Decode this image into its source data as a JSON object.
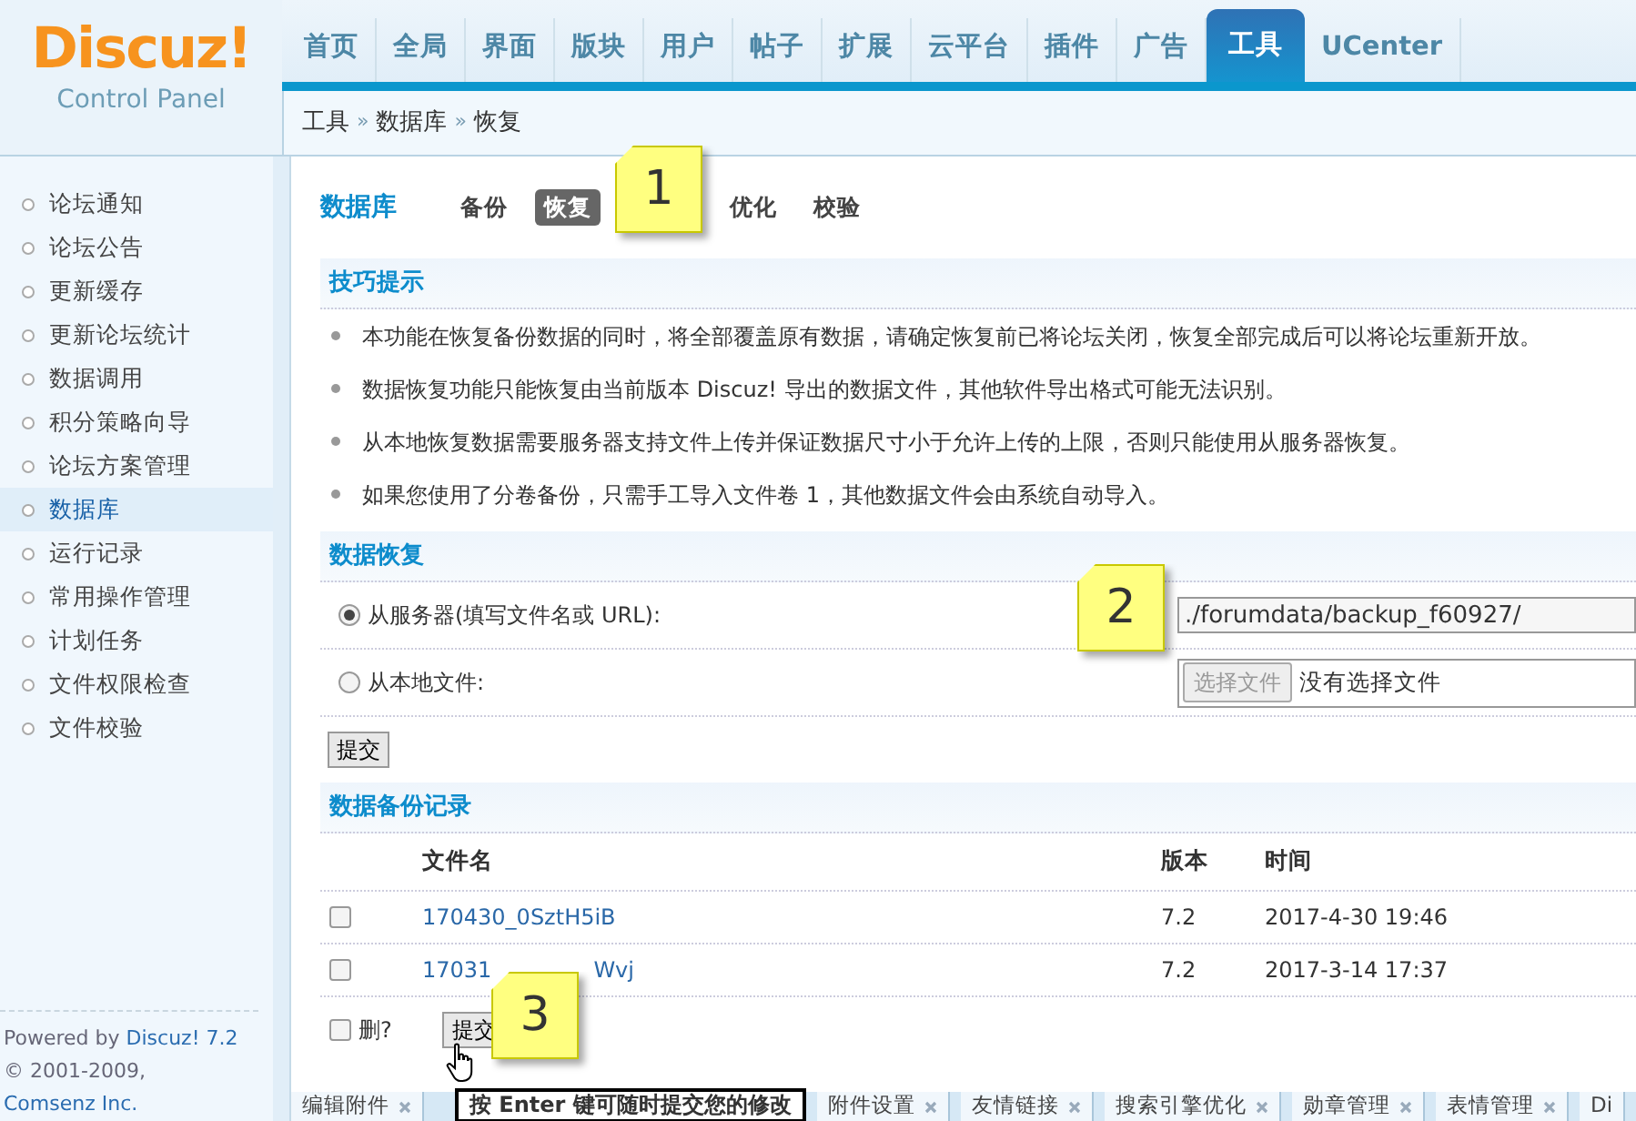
{
  "logo": {
    "title": "Discuz!",
    "subtitle": "Control Panel"
  },
  "nav_tabs": [
    {
      "label": "首页",
      "selected": false
    },
    {
      "label": "全局",
      "selected": false
    },
    {
      "label": "界面",
      "selected": false
    },
    {
      "label": "版块",
      "selected": false
    },
    {
      "label": "用户",
      "selected": false
    },
    {
      "label": "帖子",
      "selected": false
    },
    {
      "label": "扩展",
      "selected": false
    },
    {
      "label": "云平台",
      "selected": false
    },
    {
      "label": "插件",
      "selected": false
    },
    {
      "label": "广告",
      "selected": false
    },
    {
      "label": "工具",
      "selected": true
    },
    {
      "label": "UCenter",
      "selected": false
    }
  ],
  "breadcrumb": [
    "工具",
    "»",
    "数据库",
    "»",
    "恢复"
  ],
  "sidebar": {
    "items": [
      {
        "label": "论坛通知",
        "selected": false
      },
      {
        "label": "论坛公告",
        "selected": false
      },
      {
        "label": "更新缓存",
        "selected": false
      },
      {
        "label": "更新论坛统计",
        "selected": false
      },
      {
        "label": "数据调用",
        "selected": false
      },
      {
        "label": "积分策略向导",
        "selected": false
      },
      {
        "label": "论坛方案管理",
        "selected": false
      },
      {
        "label": "数据库",
        "selected": true
      },
      {
        "label": "运行记录",
        "selected": false
      },
      {
        "label": "常用操作管理",
        "selected": false
      },
      {
        "label": "计划任务",
        "selected": false
      },
      {
        "label": "文件权限检查",
        "selected": false
      },
      {
        "label": "文件校验",
        "selected": false
      }
    ]
  },
  "footer": {
    "powered": {
      "text": "Powered by",
      "link": "Discuz! 7.2"
    },
    "copyright": {
      "text": "© 2001-2009,",
      "link": "Comsenz Inc."
    }
  },
  "page_title": "数据库",
  "sub_tabs": [
    {
      "label": "备份",
      "selected": false
    },
    {
      "label": "恢复",
      "selected": true
    },
    {
      "label": "优化",
      "selected": false
    },
    {
      "label": "校验",
      "selected": false
    }
  ],
  "tips": {
    "title": "技巧提示",
    "items": [
      "本功能在恢复备份数据的同时，将全部覆盖原有数据，请确定恢复前已将论坛关闭，恢复全部完成后可以将论坛重新开放。",
      "数据恢复功能只能恢复由当前版本 Discuz! 导出的数据文件，其他软件导出格式可能无法识别。",
      "从本地恢复数据需要服务器支持文件上传并保证数据尺寸小于允许上传的上限，否则只能使用从服务器恢复。",
      "如果您使用了分卷备份，只需手工导入文件卷 1，其他数据文件会由系统自动导入。"
    ]
  },
  "restore": {
    "title": "数据恢复",
    "options": [
      {
        "kind": "text",
        "label": "从服务器(填写文件名或 URL):",
        "selected": true,
        "value": "./forumdata/backup_f60927/"
      },
      {
        "kind": "file",
        "label": "从本地文件:",
        "selected": false,
        "button": "选择文件",
        "status": "没有选择文件"
      }
    ],
    "submit": "提交"
  },
  "backups": {
    "title": "数据备份记录",
    "columns": [
      "文件名",
      "版本",
      "时间"
    ],
    "rows": [
      {
        "checked": false,
        "name_parts": [
          "170430_0SztH5iB"
        ],
        "version": "7.2",
        "time": "2017-4-30 19:46"
      },
      {
        "checked": false,
        "name_parts": [
          "17031",
          "Wvj"
        ],
        "version": "7.2",
        "time": "2017-3-14 17:37"
      }
    ],
    "delete_label": "删?",
    "delete_checked": false,
    "submit": "提交"
  },
  "tooltip": "按 Enter 键可随时提交您的修改",
  "callouts": [
    "1",
    "2",
    "3"
  ],
  "bottom_tabs": [
    {
      "label": "编辑附件",
      "closable": true
    },
    {
      "label": "附件设置",
      "closable": true
    },
    {
      "label": "友情链接",
      "closable": true
    },
    {
      "label": "搜索引擎优化",
      "closable": true
    },
    {
      "label": "勋章管理",
      "closable": true
    },
    {
      "label": "表情管理",
      "closable": true
    },
    {
      "label": "Di",
      "closable": false
    }
  ]
}
